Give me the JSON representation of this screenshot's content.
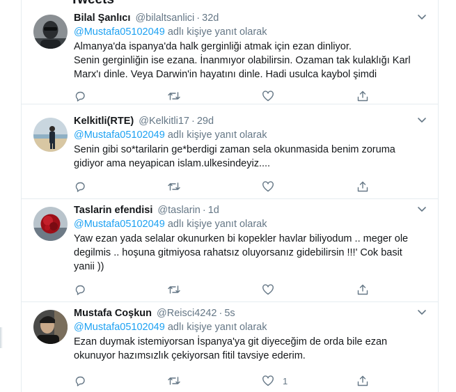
{
  "header": {
    "title": "Tweets"
  },
  "tweets": [
    {
      "name": "Bilal Şanlıcı",
      "handle": "@bilaltsanlici",
      "time": "32d",
      "reply_prefix": "@Mustafa05102049",
      "reply_suffix": " adlı kişiye yanıt olarak",
      "lines": [
        "Almanya'da ispanya'da halk gerginliği atmak için ezan dinliyor.",
        "Senin gerginliğin ise ezana. İnanmıyor olabilirsin. Ozaman tak kulaklığı Karl",
        "Marx'ı dinle. Veya Darwin'in hayatını dinle. Hadi usulca kaybol şimdi"
      ],
      "like_count": ""
    },
    {
      "name": "Kelkitli(RTE)",
      "handle": "@Kelkitli17",
      "time": "29d",
      "reply_prefix": "@Mustafa05102049",
      "reply_suffix": " adlı kişiye yanıt olarak",
      "lines": [
        "Senin gibi so*tarilarin ge*berdigi zaman sela okunmasida benim zoruma",
        "gidiyor ama neyapican islam.ulkesindeyiz...."
      ],
      "like_count": ""
    },
    {
      "name": "Taslarin efendisi",
      "handle": "@taslarin",
      "time": "1d",
      "reply_prefix": "@Mustafa05102049",
      "reply_suffix": " adlı kişiye yanıt olarak",
      "lines": [
        "Yaw ezan yada selalar okunurken bi kopekler havlar biliyodum .. meger ole",
        "degilmis .. hoşuna gitmiyosa rahatsız oluyorsanız gidebilirsin !!!' Cok basit",
        "yanii ))"
      ],
      "like_count": ""
    },
    {
      "name": "Mustafa Coşkun",
      "handle": "@Reisci4242",
      "time": "5s",
      "reply_prefix": "@Mustafa05102049",
      "reply_suffix": " adlı kişiye yanıt olarak",
      "lines": [
        "Ezan duymak istemiyorsan İspanya'ya git diyeceğim de orda bile ezan",
        "okunuyor hazımsızlık çekiyorsan fitil tavsiye ederim."
      ],
      "like_count": "1"
    }
  ],
  "icons": {
    "reply": "reply-icon",
    "retweet": "retweet-icon",
    "like": "heart-icon",
    "share": "share-icon",
    "more": "chevron-down-icon"
  },
  "colors": {
    "link": "#1da1f2",
    "secondary_text": "#657786",
    "divider": "#e6ecf0"
  }
}
